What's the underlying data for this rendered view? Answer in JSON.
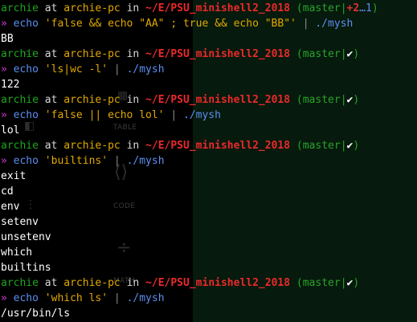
{
  "prompt": {
    "user": "archie",
    "at": "at",
    "host": "archie-pc",
    "in": "in",
    "path": "~/E/PSU_minishell2_2018",
    "branch": "master",
    "arrow": "»",
    "clean_symbol": "✔",
    "staged": "+2",
    "untracked": "…1"
  },
  "blocks": [
    {
      "dirty": true,
      "command": {
        "name": "echo",
        "arg": "'false && echo \"AA\" ; true && echo \"BB\"'",
        "pipe": "|",
        "program": "./mysh"
      },
      "output": [
        "BB"
      ]
    },
    {
      "dirty": false,
      "command": {
        "name": "echo",
        "arg": "'ls|wc -l'",
        "pipe": "|",
        "program": "./mysh"
      },
      "output": [
        "122"
      ]
    },
    {
      "dirty": false,
      "command": {
        "name": "echo",
        "arg": "'false || echo lol'",
        "pipe": "|",
        "program": "./mysh"
      },
      "output": [
        "lol"
      ]
    },
    {
      "dirty": false,
      "command": {
        "name": "echo",
        "arg": "'builtins'",
        "pipe": "|",
        "program": "./mysh"
      },
      "output": [
        "exit",
        "cd",
        "env",
        "setenv",
        "unsetenv",
        "which",
        "builtins"
      ]
    },
    {
      "dirty": false,
      "command": {
        "name": "echo",
        "arg": "'which ls'",
        "pipe": "|",
        "program": "./mysh"
      },
      "output": [
        "/usr/bin/ls"
      ]
    }
  ],
  "background_labels": {
    "table": "TABLE",
    "code": "CODE",
    "math": "MATH"
  },
  "colors": {
    "user": "#1ea51e",
    "host": "#e0a800",
    "path": "#ea2a2a",
    "git": "#2aa32a",
    "arrow": "#d23ad2",
    "command": "#5b8ef0",
    "string": "#e0a800",
    "right_pane_bg": "#061a0d"
  }
}
